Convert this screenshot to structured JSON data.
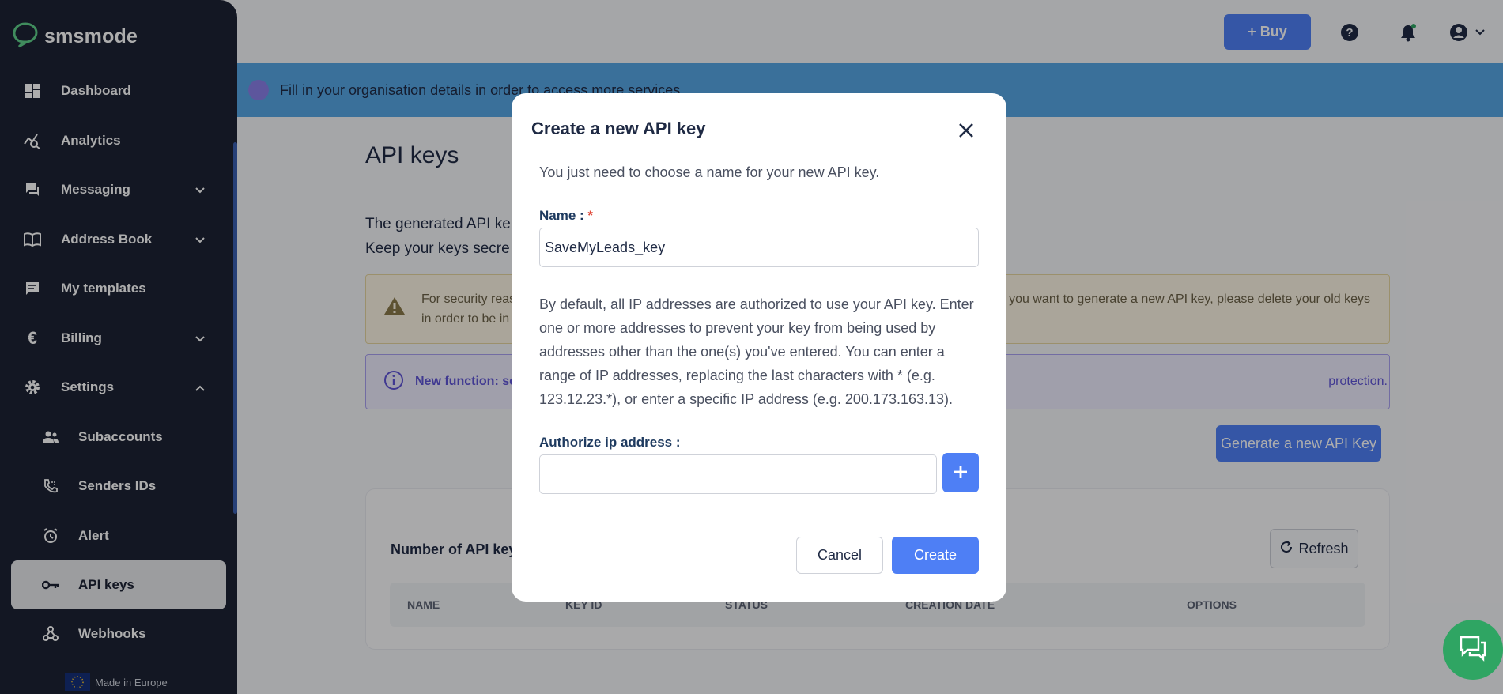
{
  "app": {
    "logo_text": "smsmode",
    "made_in": "Made in Europe"
  },
  "topbar": {
    "buy_label": "+ Buy"
  },
  "banner": {
    "link_text": "Fill in your organisation details",
    "rest_text": "in order to access more services."
  },
  "sidebar": {
    "items": [
      {
        "label": "Dashboard",
        "icon": "dashboard-icon",
        "expandable": false
      },
      {
        "label": "Analytics",
        "icon": "analytics-icon",
        "expandable": false
      },
      {
        "label": "Messaging",
        "icon": "messaging-icon",
        "expandable": true
      },
      {
        "label": "Address Book",
        "icon": "address-book-icon",
        "expandable": true
      },
      {
        "label": "My templates",
        "icon": "templates-icon",
        "expandable": false
      },
      {
        "label": "Billing",
        "icon": "euro-icon",
        "expandable": true
      },
      {
        "label": "Settings",
        "icon": "gear-icon",
        "expandable": true,
        "expanded": true
      }
    ],
    "sub_items": [
      {
        "label": "Subaccounts",
        "icon": "users-icon"
      },
      {
        "label": "Senders IDs",
        "icon": "phone-icon"
      },
      {
        "label": "Alert",
        "icon": "alarm-icon"
      },
      {
        "label": "API keys",
        "icon": "key-icon",
        "active": true
      },
      {
        "label": "Webhooks",
        "icon": "webhook-icon"
      }
    ]
  },
  "main": {
    "title": "API keys",
    "desc_line1": "The generated API ke",
    "desc_line2": "Keep your keys secre",
    "warning_line1_left": "For security reaso",
    "warning_line1_right": "you want to generate a new API key, please delete your old keys",
    "warning_line2_left": "in order to be in c",
    "info_left": "New function: se",
    "info_right": "protection.",
    "generate_label": "Generate a new API Key",
    "card_title": "Number of API keys",
    "refresh_label": "Refresh",
    "columns": [
      "NAME",
      "KEY ID",
      "STATUS",
      "CREATION DATE",
      "OPTIONS"
    ]
  },
  "modal": {
    "title": "Create a new API key",
    "subtitle": "You just need to choose a name for your new API key.",
    "name_label": "Name :",
    "required_mark": "*",
    "name_value": "SaveMyLeads_key",
    "paragraph": "By default, all IP addresses are authorized to use your API key. Enter one or more addresses to prevent your key from being used by addresses other than the one(s) you've entered. You can enter a range of IP addresses, replacing the last characters with * (e.g. 123.12.23.*), or enter a specific IP address (e.g. 200.173.163.13).",
    "ip_label": "Authorize ip address :",
    "ip_value": "",
    "cancel_label": "Cancel",
    "create_label": "Create"
  },
  "colors": {
    "sidebar_bg": "#1c2234",
    "primary": "#4e7ff5",
    "banner_bg": "#56a6e4",
    "chat_bg": "#2fa563"
  }
}
